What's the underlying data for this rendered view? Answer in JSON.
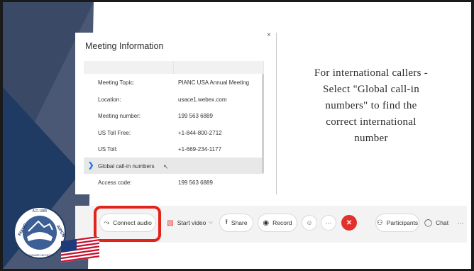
{
  "meeting_info": {
    "title": "Meeting Information",
    "close_glyph": "×",
    "rows": [
      {
        "label": "Meeting Topic:",
        "value": "PIANC USA Annual Meeting"
      },
      {
        "label": "Location:",
        "value": "usace1.webex.com"
      },
      {
        "label": "Meeting number:",
        "value": "199 563 6889"
      },
      {
        "label": "US Toll Free:",
        "value": "+1-844-800-2712"
      },
      {
        "label": "US Toll:",
        "value": "+1-669-234-1177"
      },
      {
        "label": "Global call-in numbers",
        "value": ""
      },
      {
        "label": "Access code:",
        "value": "199 563 6889"
      }
    ]
  },
  "instructions": {
    "lines": [
      "For international callers -",
      "Select \"Global call-in",
      "numbers\" to find the",
      "correct international",
      "number"
    ]
  },
  "toolbar": {
    "connect_audio": "Connect audio",
    "start_video": "Start video",
    "share": "Share",
    "record": "Record",
    "participants": "Participants",
    "chat": "Chat"
  },
  "logo": {
    "top_text": "A.D.1885",
    "left_text": "PIANC",
    "right_text": "AIPCN",
    "bottom_text": "NAVIGARE NECESSE"
  },
  "colors": {
    "accent_red": "#e2231a",
    "end_call_red": "#e2312b",
    "navy": "#1f3a63",
    "slate": "#3a4a66"
  }
}
